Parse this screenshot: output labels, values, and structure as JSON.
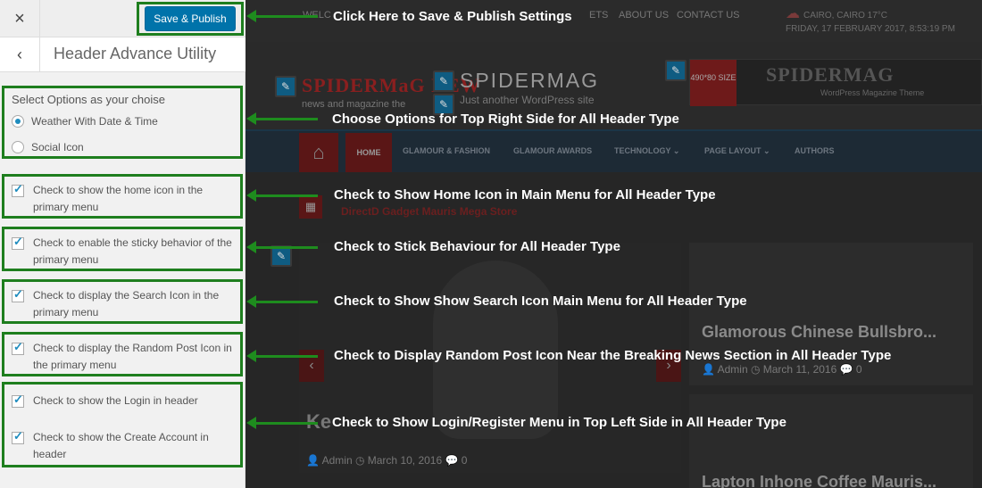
{
  "customizer": {
    "close_glyph": "×",
    "publish_label": "Save & Publish",
    "back_glyph": "‹",
    "section_title": "Header Advance Utility",
    "options_title": "Select Options as your choise",
    "radios": [
      {
        "label": "Weather With Date & Time",
        "checked": true
      },
      {
        "label": "Social Icon",
        "checked": false
      }
    ],
    "checks": [
      {
        "label": "Check to show the home icon in the primary menu",
        "checked": true
      },
      {
        "label": "Check to enable the sticky behavior of the primary menu",
        "checked": true
      },
      {
        "label": "Check to display the Search Icon in the primary menu",
        "checked": true
      },
      {
        "label": "Check to display the Random Post Icon in the primary menu",
        "checked": true
      },
      {
        "label": "Check to show the Login in header",
        "checked": true
      },
      {
        "label": "Check to show the Create Account in header",
        "checked": true
      }
    ]
  },
  "annotations": [
    "Click Here to Save & Publish Settings",
    "Choose Options for Top Right Side for All Header Type",
    "Check to Show Home Icon in Main Menu for All Header Type",
    "Check to Stick Behaviour for All Header Type",
    "Check to Show Show Search Icon Main Menu for All Header Type",
    "Check to Display Random Post Icon Near the Breaking News Section in All Header Type",
    "Check to Show Login/Register Menu in Top Left Side in All Header Type"
  ],
  "preview": {
    "top_menu": [
      "WELC",
      "ETS",
      "ABOUT US",
      "CONTACT US"
    ],
    "weather_line1": "CAIRO, CAIRO 17°C",
    "weather_line2": "FRIDAY, 17 FEBRUARY 2017, 8:53:19 PM",
    "logo_text": "SPIDERMaG NEW",
    "logo_sub": "news and magazine the",
    "site_name": "SPIDERMAG",
    "tagline": "Just another WordPress site",
    "ad_size": "490*80 SIZE",
    "ad_title": "SPIDERMAG",
    "ad_tagline": "WordPress Magazine Theme",
    "nav_items": [
      "HOME",
      "GLAMOUR & FASHION",
      "GLAMOUR AWARDS",
      "TECHNOLOGY ⌄",
      "PAGE LAYOUT ⌄",
      "AUTHORS"
    ],
    "breaking": "DirectD Gadget Mauris Mega Store",
    "slider_title": "Ke",
    "slider_meta": "👤 Admin  ◷ March 10, 2016  💬 0",
    "card1_title": "Glamorous Chinese Bullsbro...",
    "card1_meta": "👤 Admin  ◷ March 11, 2016  💬 0",
    "card2_title": "Lapton Inhone Coffee Mauris..."
  }
}
